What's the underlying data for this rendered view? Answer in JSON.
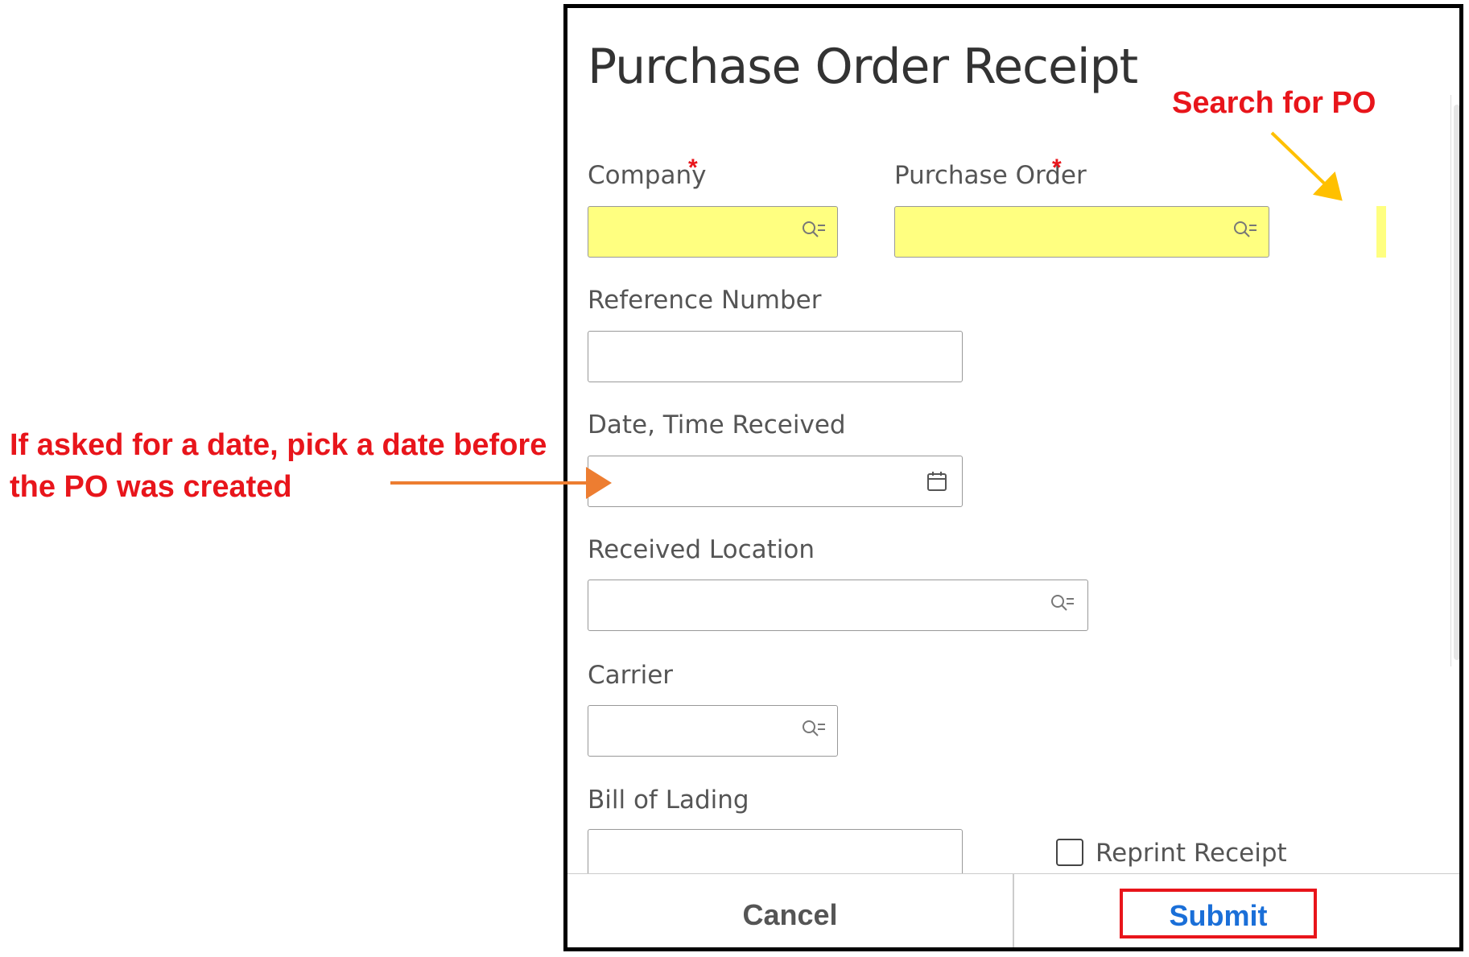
{
  "annotations": {
    "date_hint_line1": "If asked for a date, pick a date before",
    "date_hint_line2": "the PO was created",
    "search_hint": "Search for PO"
  },
  "dialog": {
    "title": "Purchase Order Receipt",
    "fields": {
      "company": {
        "label": "Company",
        "required_mark": "*",
        "value": "",
        "icon": "search-list-icon"
      },
      "purchase_order": {
        "label": "Purchase Order",
        "required_mark": "*",
        "value": "",
        "icon": "search-list-icon"
      },
      "reference_number": {
        "label": "Reference Number",
        "value": ""
      },
      "date_time_received": {
        "label": "Date, Time Received",
        "value": "",
        "icon": "calendar-icon"
      },
      "received_location": {
        "label": "Received Location",
        "value": "",
        "icon": "search-list-icon"
      },
      "carrier": {
        "label": "Carrier",
        "value": "",
        "icon": "search-list-icon"
      },
      "bill_of_lading": {
        "label": "Bill of Lading",
        "value": ""
      }
    },
    "reprint_receipt": {
      "label": "Reprint Receipt",
      "checked": false
    },
    "footer": {
      "cancel_label": "Cancel",
      "submit_label": "Submit"
    }
  },
  "colors": {
    "annotation_red": "#e8151b",
    "highlight_yellow": "#ffff80",
    "arrow_orange": "#ed7d31",
    "arrow_gold": "#ffc000",
    "submit_blue": "#1a6fd8"
  }
}
